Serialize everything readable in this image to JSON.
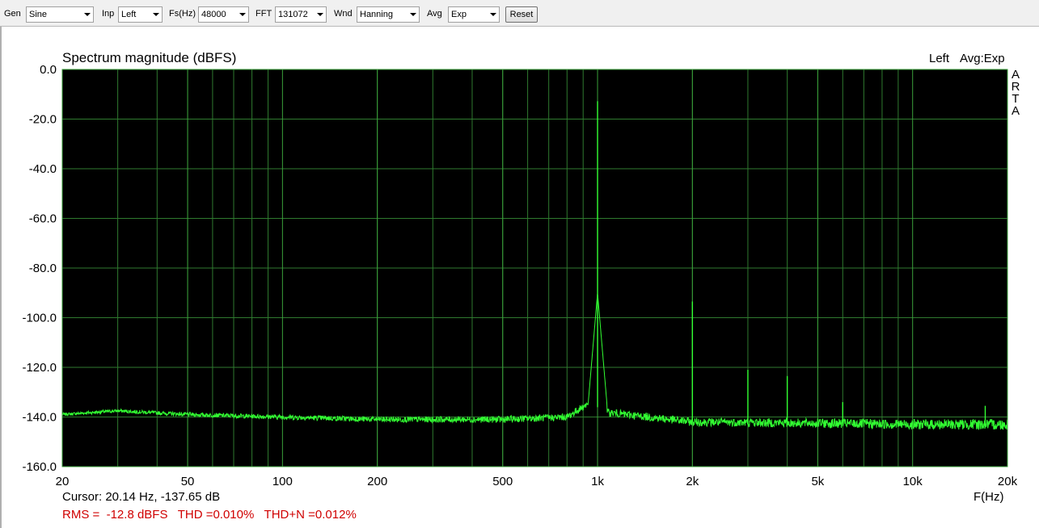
{
  "toolbar": {
    "gen_label": "Gen",
    "gen_value": "Sine",
    "inp_label": "Inp",
    "inp_value": "Left",
    "fs_label": "Fs(Hz)",
    "fs_value": "48000",
    "fft_label": "FFT",
    "fft_value": "131072",
    "wnd_label": "Wnd",
    "wnd_value": "Hanning",
    "avg_label": "Avg",
    "avg_value": "Exp",
    "reset_label": "Reset"
  },
  "plot": {
    "channel_label": "Left",
    "avg_label": "Avg:Exp",
    "brand_letters": [
      "A",
      "R",
      "T",
      "A"
    ],
    "cursor_readout": "Cursor: 20.14 Hz, -137.65 dB",
    "stats": "RMS =  -12.8 dBFS   THD =0.010%   THD+N =0.012%"
  },
  "colors": {
    "background": "#000000",
    "grid": "#2f7a2f",
    "frame": "#3aa03a",
    "trace": "#32ff32",
    "stats_text": "#d00000"
  },
  "chart_data": {
    "type": "line",
    "title": "Spectrum magnitude (dBFS)",
    "xlabel": "F(Hz)",
    "ylabel": "",
    "xscale": "log",
    "xlim": [
      20,
      20000
    ],
    "ylim": [
      -160,
      0
    ],
    "x_ticks": [
      20,
      50,
      100,
      200,
      500,
      1000,
      2000,
      5000,
      10000,
      20000
    ],
    "x_tick_labels": [
      "20",
      "50",
      "100",
      "200",
      "500",
      "1k",
      "2k",
      "5k",
      "10k",
      "20k"
    ],
    "y_ticks": [
      0,
      -20,
      -40,
      -60,
      -80,
      -100,
      -120,
      -140,
      -160
    ],
    "y_tick_labels": [
      "0.0",
      "-20.0",
      "-40.0",
      "-60.0",
      "-80.0",
      "-100.0",
      "-120.0",
      "-140.0",
      "-160.0"
    ],
    "grid": true,
    "series": [
      {
        "noise_floor": [
          [
            20,
            -139
          ],
          [
            30,
            -137.5
          ],
          [
            50,
            -139
          ],
          [
            100,
            -140
          ],
          [
            200,
            -141
          ],
          [
            500,
            -141
          ],
          [
            800,
            -140
          ],
          [
            950,
            -134
          ],
          [
            1050,
            -138
          ],
          [
            2000,
            -142
          ],
          [
            5000,
            -142.5
          ],
          [
            10000,
            -143
          ],
          [
            20000,
            -143
          ]
        ],
        "peaks": [
          [
            1000,
            -12.8
          ],
          [
            2000,
            -93.5
          ],
          [
            3000,
            -121
          ],
          [
            4000,
            -123.5
          ],
          [
            6000,
            -134
          ],
          [
            17000,
            -135.5
          ]
        ]
      }
    ]
  }
}
